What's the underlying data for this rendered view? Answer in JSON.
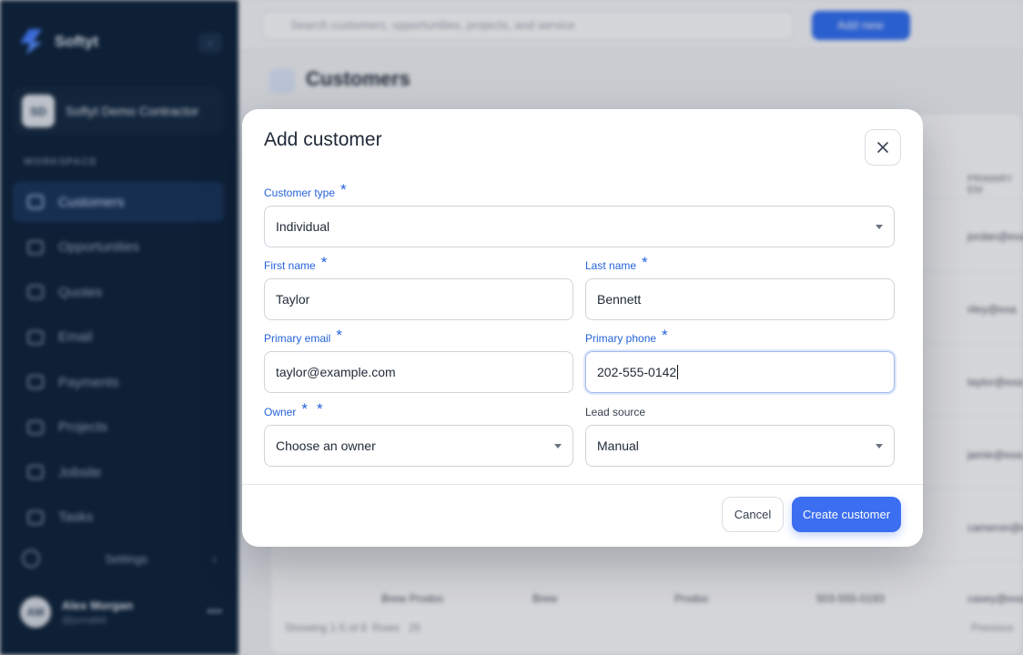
{
  "sidebar": {
    "brand": "Softyt",
    "org_name": "Softyt Demo Contractor",
    "org_initials": "SD",
    "section_label": "WORKSPACE",
    "items": [
      {
        "label": "Customers"
      },
      {
        "label": "Opportunities"
      },
      {
        "label": "Quotes"
      },
      {
        "label": "Email"
      },
      {
        "label": "Payments"
      },
      {
        "label": "Projects"
      },
      {
        "label": "Jobsite"
      },
      {
        "label": "Tasks"
      }
    ],
    "settings_label": "Settings",
    "user": {
      "initials": "AM",
      "name": "Alex Morgan",
      "sub": "@jurnalist"
    }
  },
  "topbar": {
    "search_placeholder": "Search customers, opportunities, projects, and service",
    "add_new_label": "Add new"
  },
  "page": {
    "title": "Customers",
    "rows": [
      {
        "email": "jordan@exa"
      },
      {
        "email": "riley@exa"
      },
      {
        "email": "taylor@exa"
      },
      {
        "email": "jamie@exa"
      },
      {
        "email": "cameron@exa"
      }
    ],
    "last_row": [
      "Brew Prodoc",
      "Brew",
      "Prodoc",
      "503-555-0193",
      "casey@exa"
    ],
    "header_partial": "PRIMARY EM",
    "footer": {
      "showing": "Showing 1-5 of 8",
      "rows_label": "Rows",
      "rows_value": "25",
      "prev": "Previous"
    }
  },
  "modal": {
    "title": "Add customer",
    "customer_type": {
      "label": "Customer type",
      "value": "Individual"
    },
    "first_name": {
      "label": "First name",
      "value": "Taylor"
    },
    "last_name": {
      "label": "Last name",
      "value": "Bennett"
    },
    "primary_email": {
      "label": "Primary email",
      "value": "taylor@example.com"
    },
    "primary_phone": {
      "label": "Primary phone",
      "value": "202-555-0142"
    },
    "owner": {
      "label": "Owner",
      "value": "Choose an owner"
    },
    "lead_source": {
      "label": "Lead source",
      "value": "Manual"
    },
    "required_mark": "*",
    "cancel_label": "Cancel",
    "create_label": "Create customer"
  },
  "colors": {
    "accent": "#3b6ef0",
    "label_blue": "#2563d9",
    "sidebar_bg": "#0c2138"
  }
}
